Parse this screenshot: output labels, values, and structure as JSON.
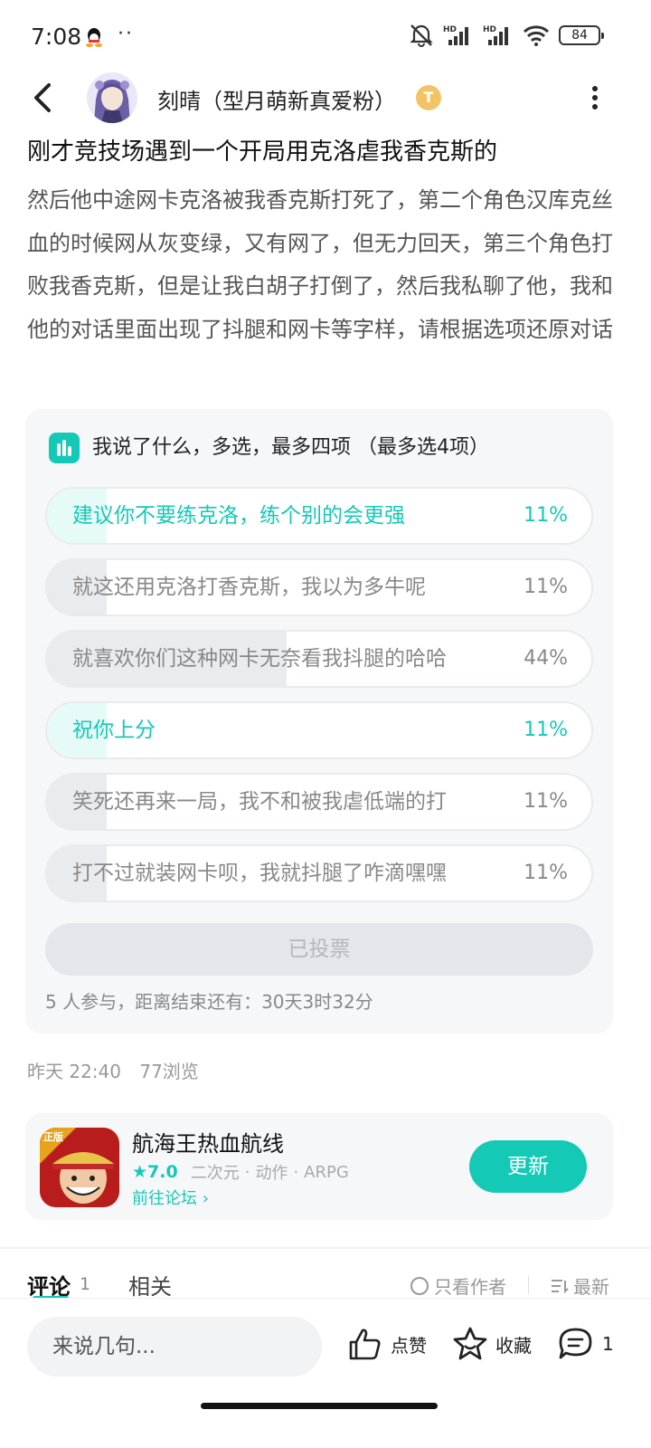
{
  "status_bar": {
    "time": "7:08",
    "extra_dots": "··",
    "battery": "84"
  },
  "header": {
    "author_name": "刻晴（型月萌新真爱粉）",
    "badge_text": "T"
  },
  "post": {
    "title": "刚才竞技场遇到一个开局用克洛虐我香克斯的",
    "body": "然后他中途网卡克洛被我香克斯打死了，第二个角色汉库克丝血的时候网从灰变绿，又有网了，但无力回天，第三个角色打败我香克斯，但是让我白胡子打倒了，然后我私聊了他，我和他的对话里面出现了抖腿和网卡等字样，请根据选项还原对话",
    "date": "昨天 22:40",
    "views": "77浏览"
  },
  "poll": {
    "title": "我说了什么，多选，最多四项",
    "limit_note": "（最多选4项）",
    "options": [
      {
        "label": "建议你不要练克洛，练个别的会更强",
        "percent": "11%",
        "fill": 0.11,
        "selected": true
      },
      {
        "label": "就这还用克洛打香克斯，我以为多牛呢",
        "percent": "11%",
        "fill": 0.11,
        "selected": false
      },
      {
        "label": "就喜欢你们这种网卡无奈看我抖腿的哈哈",
        "percent": "44%",
        "fill": 0.44,
        "selected": false
      },
      {
        "label": "祝你上分",
        "percent": "11%",
        "fill": 0.11,
        "selected": true
      },
      {
        "label": "笑死还再来一局，我不和被我虐低端的打",
        "percent": "11%",
        "fill": 0.11,
        "selected": false
      },
      {
        "label": "打不过就装网卡呗，我就抖腿了咋滴嘿嘿",
        "percent": "11%",
        "fill": 0.11,
        "selected": false
      }
    ],
    "voted_label": "已投票",
    "footer": "5 人参与，距离结束还有：30天3时32分"
  },
  "app_card": {
    "name": "航海王热血航线",
    "rating": "★7.0",
    "tags": [
      "二次元",
      "·",
      "动作",
      "·",
      "ARPG"
    ],
    "forum_link": "前往论坛 ›",
    "icon_badge": "正版",
    "update_label": "更新"
  },
  "comments": {
    "tab_comments": "评论",
    "comment_count": "1",
    "tab_related": "相关",
    "author_only": "只看作者",
    "sort_latest": "最新"
  },
  "bottom_bar": {
    "input_placeholder": "来说几句...",
    "like_label": "点赞",
    "favorite_label": "收藏",
    "comment_count": "1"
  },
  "colors": {
    "accent": "#15c9b7",
    "poll_background": "#f6f7f9"
  }
}
